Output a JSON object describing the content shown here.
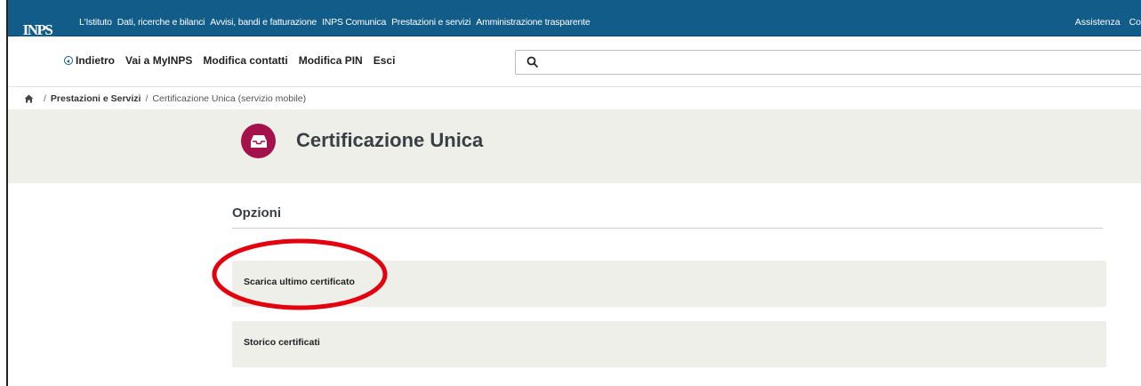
{
  "brand": {
    "logo_text": "INPS",
    "primary_color": "#125c8a",
    "accent_color": "#a3124a",
    "annotation_color": "#e3000f"
  },
  "topnav": {
    "items": [
      "L'Istituto",
      "Dati, ricerche e bilanci",
      "Avvisi, bandi e fatturazione",
      "INPS Comunica",
      "Prestazioni e servizi",
      "Amministrazione trasparente"
    ],
    "right_items": [
      "Assistenza",
      "Co"
    ]
  },
  "subnav": {
    "back_label": "Indietro",
    "items": [
      "Vai a MyINPS",
      "Modifica contatti",
      "Modifica PIN",
      "Esci"
    ]
  },
  "search": {
    "placeholder": "",
    "icon": "search-icon"
  },
  "breadcrumb": {
    "home_icon": "home-icon",
    "items": [
      "Prestazioni e Servizi",
      "Certificazione Unica (servizio mobile)"
    ]
  },
  "header": {
    "title": "Certificazione Unica",
    "icon": "inbox-tray-icon"
  },
  "options": {
    "title": "Opzioni",
    "items": [
      "Scarica ultimo certificato",
      "Storico certificati"
    ]
  }
}
